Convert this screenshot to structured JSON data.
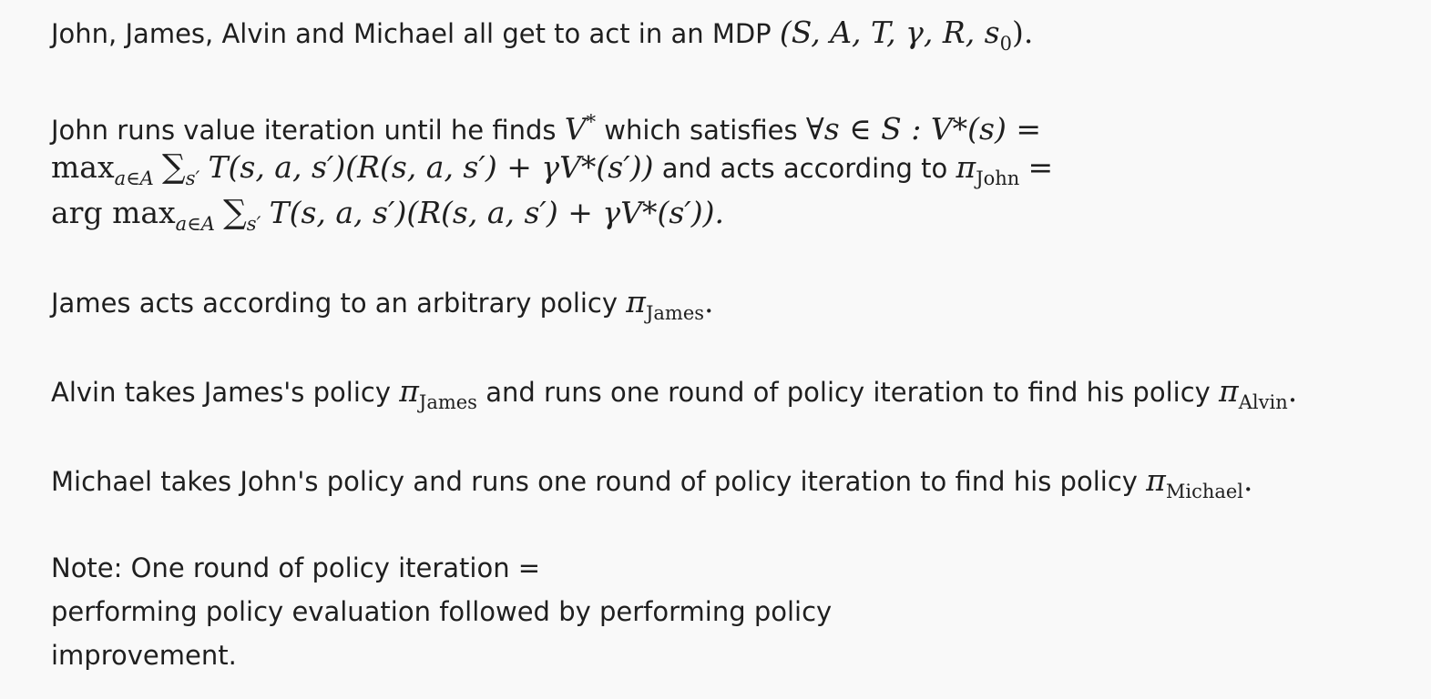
{
  "problem": {
    "intro": {
      "text": "John, James, Alvin and Michael all get to act in an MDP",
      "math": "(S, A, T, γ, R, s",
      "math_sub": "0",
      "math_close": ")."
    },
    "john": {
      "line1_text": "John runs value iteration until he finds",
      "v_star": "V",
      "star": "*",
      "which": "which satisfies",
      "condition": "∀s ∈ S : V*(s) =",
      "max": "max",
      "max_sub": "a∈A",
      "sum": "∑",
      "sum_sub": "s′",
      "bellman": "T(s, a, s′)(R(s, a, s′) + γV*(s′))",
      "acts_text": "and acts according to",
      "pi": "π",
      "pi_sub": "John",
      "equals": "=",
      "argmax": "arg max",
      "argmax_sub": "a∈A",
      "bellman_end": "T(s, a, s′)(R(s, a, s′) + γV*(s′))."
    },
    "james": {
      "text": "James acts according to an arbitrary policy",
      "pi": "π",
      "pi_sub": "James",
      "end": "."
    },
    "alvin": {
      "text_a": "Alvin takes James's policy",
      "pi1": "π",
      "pi1_sub": "James",
      "text_b": "and runs one round of policy iteration to find his policy",
      "pi2": "π",
      "pi2_sub": "Alvin",
      "end": "."
    },
    "michael": {
      "text": "Michael takes John's policy and runs one round of policy iteration to find his policy",
      "pi": "π",
      "pi_sub": "Michael",
      "end": "."
    },
    "note": {
      "line1": "Note: One round of policy iteration =",
      "line2": "performing policy evaluation followed by performing policy",
      "line3": "improvement."
    }
  }
}
